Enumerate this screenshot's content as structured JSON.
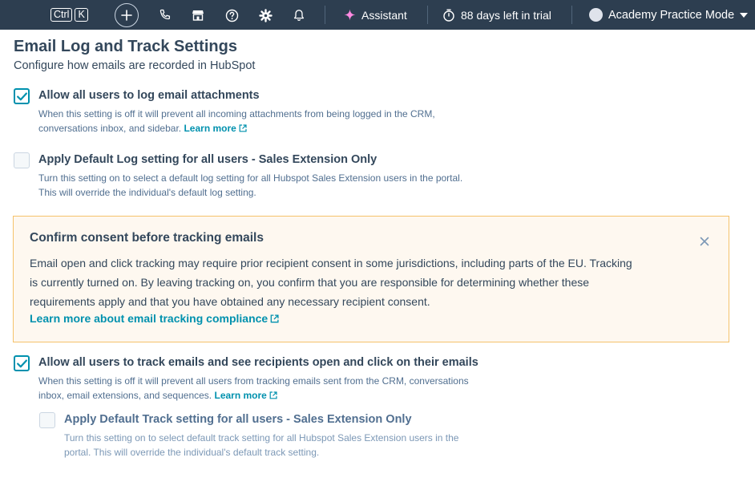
{
  "topbar": {
    "kbd_ctrl": "Ctrl",
    "kbd_k": "K",
    "assistant_label": "Assistant",
    "trial_label": "88 days left in trial",
    "account_label": "Academy Practice Mode",
    "icons": [
      "plus-icon",
      "phone-icon",
      "marketplace-icon",
      "help-icon",
      "settings-icon",
      "bell-icon",
      "sparkle-icon",
      "timer-icon",
      "avatar",
      "caret-down-icon"
    ]
  },
  "page": {
    "title": "Email Log and Track Settings",
    "subtitle": "Configure how emails are recorded in HubSpot"
  },
  "settings": {
    "attachments": {
      "checked": true,
      "label": "Allow all users to log email attachments",
      "desc_line1": "When this setting is off it will prevent all incoming attachments from being logged in the CRM,",
      "desc_line2": "conversations inbox, and sidebar.",
      "link": "Learn more"
    },
    "default_log": {
      "checked": false,
      "label": "Apply Default Log setting for all users - Sales Extension Only",
      "desc_line1": "Turn this setting on to select a default log setting for all Hubspot Sales Extension users in the portal.",
      "desc_line2": "This will override the individual's default log setting."
    },
    "track": {
      "checked": true,
      "label": "Allow all users to track emails and see recipients open and click on their emails",
      "desc_line1": "When this setting is off it will prevent all users from tracking emails sent from the CRM, conversations",
      "desc_line2": "inbox, email extensions, and sequences.",
      "link": "Learn more"
    },
    "default_track": {
      "checked": false,
      "label": "Apply Default Track setting for all users - Sales Extension Only",
      "desc_line1": "Turn this setting on to select default track setting for all Hubspot Sales Extension users in the",
      "desc_line2": "portal. This will override the individual's default track setting."
    }
  },
  "alert": {
    "title": "Confirm consent before tracking emails",
    "line1": "Email open and click tracking may require prior recipient consent in some jurisdictions, including parts of the EU. Tracking",
    "line2": "is currently turned on. By leaving tracking on, you confirm that you are responsible for determining whether these",
    "line3": "requirements apply and that you have obtained any necessary recipient consent.",
    "link": "Learn more about email tracking compliance"
  },
  "colors": {
    "topbar_bg": "#2d3e50",
    "link": "#0091ae",
    "checkbox_checked": "#0091ae",
    "alert_bg": "#fef8f0",
    "alert_border": "#f5c26b",
    "assistant_sparkle": "#ff8ae2"
  }
}
